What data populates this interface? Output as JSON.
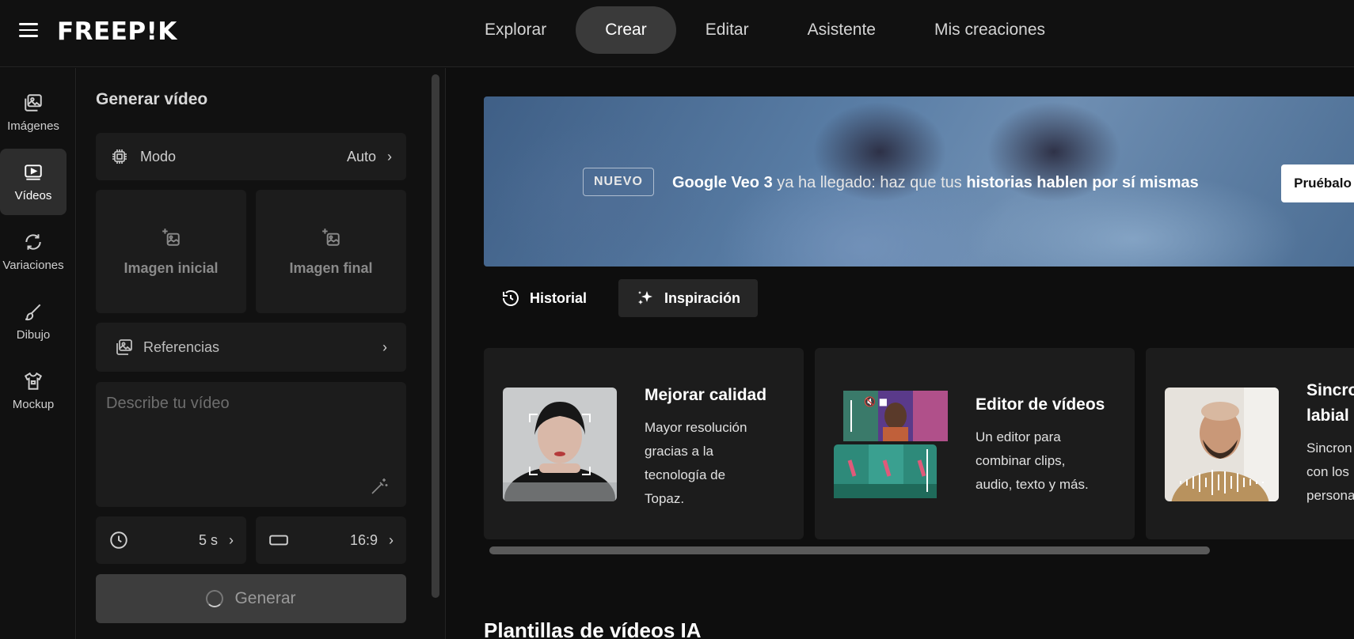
{
  "header": {
    "logo": "FREEP!K",
    "nav": [
      {
        "label": "Explorar",
        "active": false
      },
      {
        "label": "Crear",
        "active": true
      },
      {
        "label": "Editar",
        "active": false
      },
      {
        "label": "Asistente",
        "active": false
      },
      {
        "label": "Mis creaciones",
        "active": false
      }
    ]
  },
  "rail": {
    "items": [
      {
        "label": "Imágenes",
        "icon": "images-icon"
      },
      {
        "label": "Vídeos",
        "icon": "video-icon",
        "active": true
      },
      {
        "label": "Variaciones",
        "icon": "refresh-icon"
      },
      {
        "label": "Dibujo",
        "icon": "brush-icon"
      },
      {
        "label": "Mockup",
        "icon": "tshirt-icon"
      }
    ]
  },
  "panel": {
    "title": "Generar vídeo",
    "mode_label": "Modo",
    "mode_value": "Auto",
    "start_image": "Imagen inicial",
    "end_image": "Imagen final",
    "references": "Referencias",
    "describe_placeholder": "Describe tu vídeo",
    "duration": "5 s",
    "aspect": "16:9",
    "generate": "Generar"
  },
  "banner": {
    "badge": "NUEVO",
    "text_bold1": "Google Veo 3",
    "text_plain": " ya ha llegado: haz que tus ",
    "text_bold2": "historias hablen por sí mismas",
    "cta": "Pruébalo"
  },
  "tabs": {
    "history": "Historial",
    "inspiration": "Inspiración"
  },
  "features": [
    {
      "title": "Mejorar calidad",
      "desc": [
        "Mayor resolución",
        "gracias a la",
        "tecnología de",
        "Topaz."
      ]
    },
    {
      "title": "Editor de vídeos",
      "desc": [
        "Un editor para",
        "combinar clips,",
        "audio, texto y más."
      ]
    },
    {
      "title": "Sincro",
      "title2": "labial",
      "desc": [
        "Sincron",
        "con los",
        "persona"
      ]
    }
  ],
  "section_title": "Plantillas de vídeos IA",
  "colors": {
    "bg": "#0e0e0e",
    "panel": "#111111",
    "card": "#1c1c1c",
    "active": "#3a3a3a"
  }
}
